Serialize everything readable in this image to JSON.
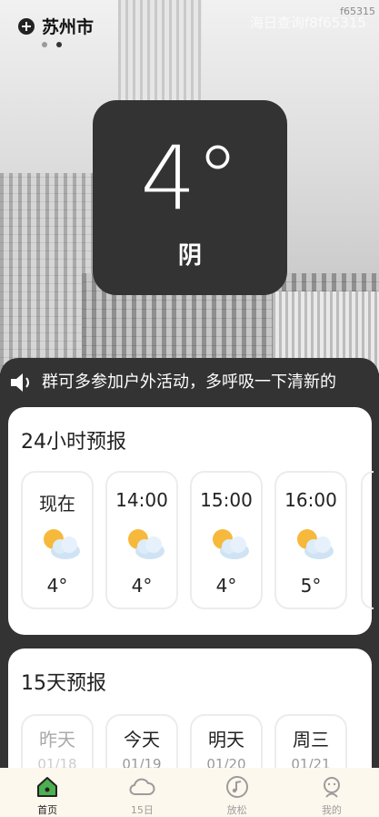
{
  "header": {
    "city": "苏州市",
    "corner_code": "f65315",
    "watermark": "海日查询f8f65315"
  },
  "current": {
    "temperature": "4°",
    "condition": "阴"
  },
  "ticker": {
    "text": "群可多参加户外活动，多呼吸一下清新的"
  },
  "hourly": {
    "title": "24小时预报",
    "items": [
      {
        "time": "现在",
        "icon": "cloudy-sun-icon",
        "temp": "4°"
      },
      {
        "time": "14:00",
        "icon": "cloudy-sun-icon",
        "temp": "4°"
      },
      {
        "time": "15:00",
        "icon": "cloudy-sun-icon",
        "temp": "4°"
      },
      {
        "time": "16:00",
        "icon": "cloudy-sun-icon",
        "temp": "5°"
      }
    ]
  },
  "daily": {
    "title": "15天预报",
    "items": [
      {
        "label": "昨天",
        "date": "01/18"
      },
      {
        "label": "今天",
        "date": "01/19"
      },
      {
        "label": "明天",
        "date": "01/20"
      },
      {
        "label": "周三",
        "date": "01/21"
      }
    ]
  },
  "tabbar": {
    "items": [
      {
        "label": "首页",
        "icon": "home-icon"
      },
      {
        "label": "15日",
        "icon": "cloud-icon"
      },
      {
        "label": "放松",
        "icon": "music-icon"
      },
      {
        "label": "我的",
        "icon": "profile-icon"
      }
    ],
    "active_index": 0
  },
  "colors": {
    "card_dark": "#333333",
    "tabbar_bg": "#fdf8ee",
    "home_accent": "#4caf50"
  }
}
